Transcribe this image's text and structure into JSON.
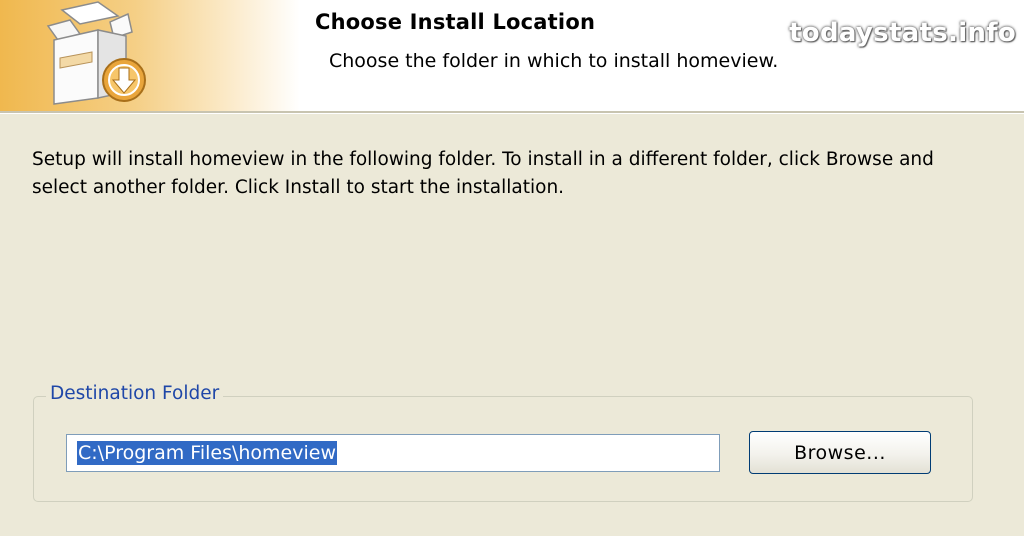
{
  "header": {
    "title": "Choose Install Location",
    "subtitle": "Choose the folder in which to install homeview."
  },
  "watermark": "todaystats.info",
  "body": {
    "description": "Setup will install homeview in the following folder. To install in a different folder, click Browse and select another folder. Click Install to start the installation."
  },
  "destination": {
    "group_label": "Destination Folder",
    "path_value": "C:\\Program Files\\homeview",
    "browse_label": "Browse..."
  },
  "icons": {
    "installer": "installer-box-icon"
  },
  "colors": {
    "window_bg": "#ece9d8",
    "header_accent": "#f0b84e",
    "selection": "#316ac5",
    "group_label": "#1f47a8"
  }
}
